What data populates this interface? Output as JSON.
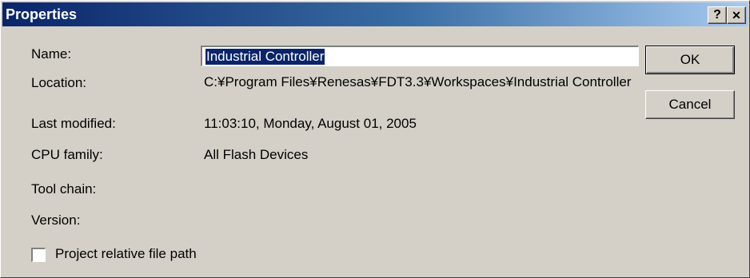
{
  "window": {
    "title": "Properties",
    "help_button": "?",
    "close_button": "✕"
  },
  "fields": {
    "name": {
      "label": "Name:",
      "value": "Industrial Controller"
    },
    "location": {
      "label": "Location:",
      "value": "C:¥Program Files¥Renesas¥FDT3.3¥Workspaces¥Industrial Controller"
    },
    "last_modified": {
      "label": "Last modified:",
      "value": "11:03:10, Monday, August 01, 2005"
    },
    "cpu_family": {
      "label": "CPU family:",
      "value": "All Flash Devices"
    },
    "tool_chain": {
      "label": "Tool chain:",
      "value": ""
    },
    "version": {
      "label": "Version:",
      "value": ""
    }
  },
  "buttons": {
    "ok": "OK",
    "cancel": "Cancel"
  },
  "checkbox": {
    "label": "Project relative file path",
    "checked": false
  },
  "colors": {
    "dialog_face": "#d4d0c8",
    "title_gradient_start": "#0a246a",
    "title_gradient_end": "#a6caf0",
    "selection": "#0a246a"
  }
}
